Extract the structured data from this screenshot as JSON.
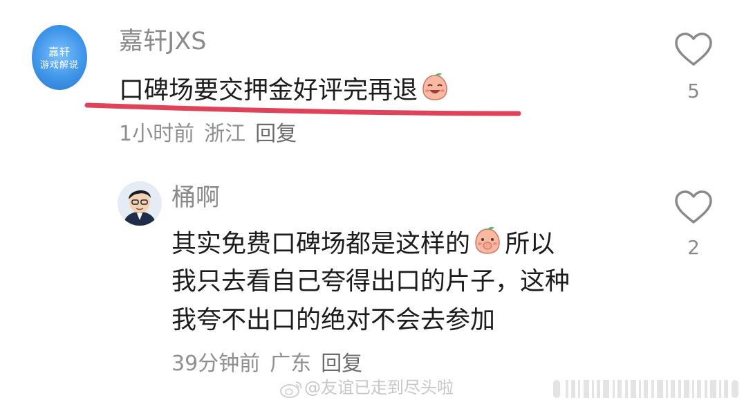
{
  "comments": [
    {
      "username": "嘉轩JXS",
      "avatar_text_line1": "嘉轩",
      "avatar_text_line2": "游戏解说",
      "text": "口碑场要交押金好评完再退",
      "text_emoji": "peach-face-laugh-emoji",
      "time": "1小时前",
      "location": "浙江",
      "reply_label": "回复",
      "likes": "5",
      "underline_color": "#e0425a"
    },
    {
      "username": "桶啊",
      "text_line1": "其实免费口碑场都是这样的",
      "text_line1_end": "所以",
      "text_line2": "我只去看自己夸得出口的片子，这种",
      "text_line3": "我夸不出口的绝对不会去参加",
      "text_emoji": "peach-face-shy-emoji",
      "time": "39分钟前",
      "location": "广东",
      "reply_label": "回复",
      "likes": "2"
    }
  ],
  "watermark": {
    "text": "@友谊已走到尽头啦",
    "icon": "weibo-logo-icon"
  },
  "colors": {
    "text_primary": "#1c1c1c",
    "text_secondary": "#8a8a8a",
    "avatar1_bg": "#3f95e8",
    "underline": "#e0425a",
    "heart_stroke": "#8a8a8a"
  }
}
